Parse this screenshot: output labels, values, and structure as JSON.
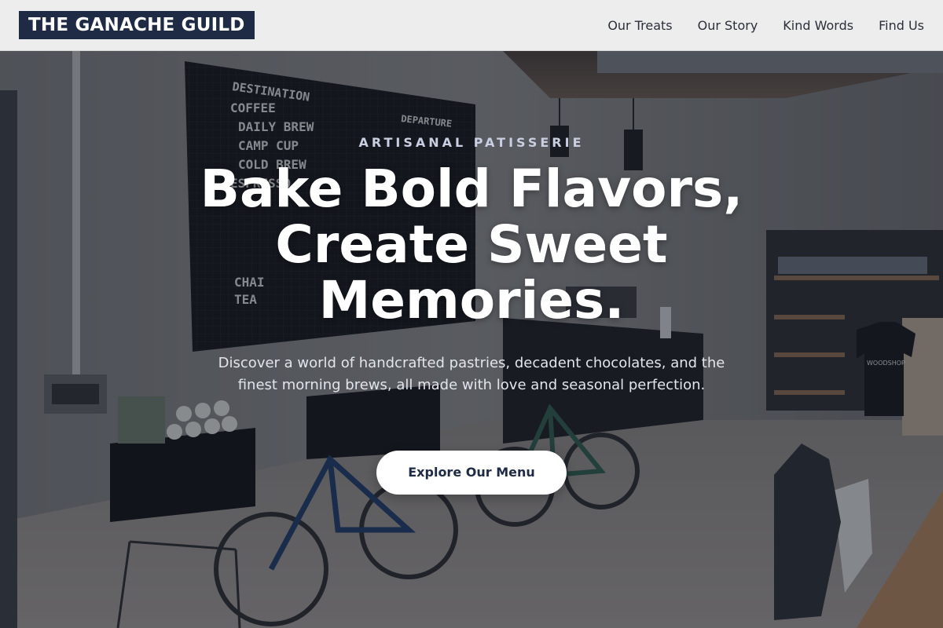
{
  "brand": {
    "logo_text": "THE GANACHE GUILD"
  },
  "nav": {
    "items": [
      {
        "label": "Our Treats"
      },
      {
        "label": "Our Story"
      },
      {
        "label": "Kind Words"
      },
      {
        "label": "Find Us"
      }
    ]
  },
  "hero": {
    "eyebrow": "ARTISANAL PATISSERIE",
    "headline": "Bake Bold Flavors, Create Sweet Memories.",
    "description": "Discover a world of handcrafted pastries, decadent chocolates, and the finest morning brews, all made with love and seasonal perfection.",
    "cta_label": "Explore Our Menu",
    "background": {
      "menu_board_lines": [
        "DESTINATION",
        "DEPARTURE",
        "COFFEE",
        "DAILY BREW",
        "CAMP CUP",
        "COLD BREW",
        "ESPRESSO",
        "CHAI",
        "TEA"
      ],
      "tshirt_text": "WOODSHOP"
    }
  },
  "colors": {
    "nav_background": "#ededed",
    "logo_background": "#1f2a44",
    "overlay": "rgba(20,26,42,0.42)",
    "cta_background": "#ffffff",
    "cta_text": "#1f2a44"
  }
}
